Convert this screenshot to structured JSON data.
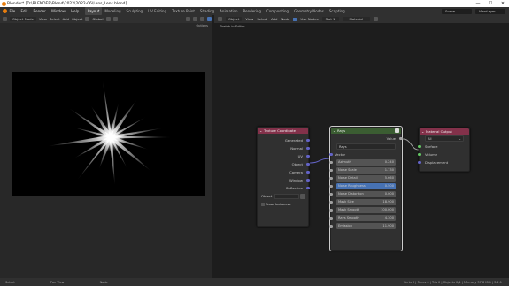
{
  "window": {
    "title": "Blender* [D:\\BLENDER\\Blend\\2022\\2022-06\\Lens_Lens.blend]",
    "minimize": "—",
    "maximize": "☐",
    "close": "✕"
  },
  "menu": [
    "File",
    "Edit",
    "Render",
    "Window",
    "Help"
  ],
  "workspaces": [
    "Layout",
    "Modeling",
    "Sculpting",
    "UV Editing",
    "Texture Paint",
    "Shading",
    "Animation",
    "Rendering",
    "Compositing",
    "Geometry Nodes",
    "Scripting"
  ],
  "active_workspace": "Layout",
  "top_right": {
    "scene": "Scene",
    "view_layer": "ViewLayer"
  },
  "left_header": {
    "mode": "Object Mode",
    "items": [
      "View",
      "Select",
      "Add",
      "Object"
    ],
    "orientation": "Global",
    "options": "Options"
  },
  "right_header": {
    "type": "Object",
    "items": [
      "View",
      "Select",
      "Add",
      "Node"
    ],
    "use_nodes_label": "Use Nodes",
    "slot": "Slot 1",
    "material": "Material"
  },
  "breadcrumb": "Sketch-in-Editor",
  "nodes": {
    "texcoord": {
      "title": "Texture Coordinate",
      "outputs": [
        "Generated",
        "Normal",
        "UV",
        "Object",
        "Camera",
        "Window",
        "Reflection"
      ],
      "object_label": "Object",
      "instancer_label": "From Instancer"
    },
    "rays": {
      "title": "Rays",
      "output": "Value",
      "group_name": "Rays",
      "vector_label": "Vector",
      "fields": [
        {
          "label": "Azimuth",
          "value": "0.240"
        },
        {
          "label": "Noise Scale",
          "value": "1.730"
        },
        {
          "label": "Noise Detail",
          "value": "5.660"
        },
        {
          "label": "Noise Roughness",
          "value": "0.500"
        },
        {
          "label": "Noise Distortion",
          "value": "0.000"
        },
        {
          "label": "Mask Size",
          "value": "18.900"
        },
        {
          "label": "Mask Smooth",
          "value": "100.000"
        },
        {
          "label": "Rays Smooth",
          "value": "4.300"
        },
        {
          "label": "Emission",
          "value": "11.900"
        }
      ]
    },
    "output": {
      "title": "Material Output",
      "target": "All",
      "inputs": [
        "Surface",
        "Volume",
        "Displacement"
      ]
    }
  },
  "status": {
    "left": "Select",
    "mid1": "Pan View",
    "mid2": "Node",
    "right": "Verts 0 | Faces 0 | Tris 0 | Objects 0/1 | Memory 37.8 MiB | 3.2.1"
  },
  "colors": {
    "texcoord_header": "#83314a",
    "rays_header": "#3b5d32",
    "output_header": "#83314a",
    "socket_vector": "#6363c7",
    "socket_float": "#a1a1a1",
    "socket_shader": "#63c763",
    "wire": "#d6d6d6",
    "highlight": "#4772b3"
  }
}
